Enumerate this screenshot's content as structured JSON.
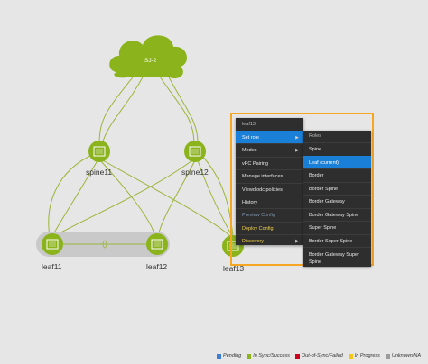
{
  "cloud": {
    "label": "SJ-2"
  },
  "nodes": {
    "spine11": "spine11",
    "spine12": "spine12",
    "leaf11": "leaf11",
    "leaf12": "leaf12",
    "leaf13": "leaf13"
  },
  "context_menu": {
    "header": "leaf13",
    "items": [
      {
        "label": "Set role",
        "state": "active",
        "has_arrow": true
      },
      {
        "label": "Modes",
        "state": "normal",
        "has_arrow": true
      },
      {
        "label": "vPC Pairing",
        "state": "normal",
        "has_arrow": false
      },
      {
        "label": "Manage interfaces",
        "state": "normal",
        "has_arrow": false
      },
      {
        "label": "Viewdiodc policies",
        "state": "normal",
        "has_arrow": false
      },
      {
        "label": "History",
        "state": "normal",
        "has_arrow": false
      },
      {
        "label": "Preview Config",
        "state": "disabled",
        "has_arrow": false
      },
      {
        "label": "Deploy Config",
        "state": "discovery",
        "has_arrow": false
      },
      {
        "label": "Discovery",
        "state": "discovery",
        "has_arrow": true
      }
    ]
  },
  "role_submenu": {
    "header": "Roles",
    "items": [
      {
        "label": "Spine",
        "active": false
      },
      {
        "label": "Leaf (current)",
        "active": true
      },
      {
        "label": "Border",
        "active": false
      },
      {
        "label": "Border Spine",
        "active": false
      },
      {
        "label": "Border Gateway",
        "active": false
      },
      {
        "label": "Border Gateway Spine",
        "active": false
      },
      {
        "label": "Super Spine",
        "active": false
      },
      {
        "label": "Border Super Spine",
        "active": false
      },
      {
        "label": "Border Gateway Super Spine",
        "active": false
      }
    ]
  },
  "legend": [
    {
      "label": "Pending",
      "color": "#3a7fd5"
    },
    {
      "label": "In Sync/Success",
      "color": "#8ab31c"
    },
    {
      "label": "Out-of-Sync/Failed",
      "color": "#d0021b"
    },
    {
      "label": "In Progress",
      "color": "#f5c518"
    },
    {
      "label": "Unknown/NA",
      "color": "#9b9b9b"
    }
  ],
  "colors": {
    "node_green": "#8ab31c",
    "link_green": "#9cb53a",
    "selection_orange": "#f5a623",
    "menu_bg": "#2e2e2e",
    "menu_active": "#1a7fd6"
  }
}
